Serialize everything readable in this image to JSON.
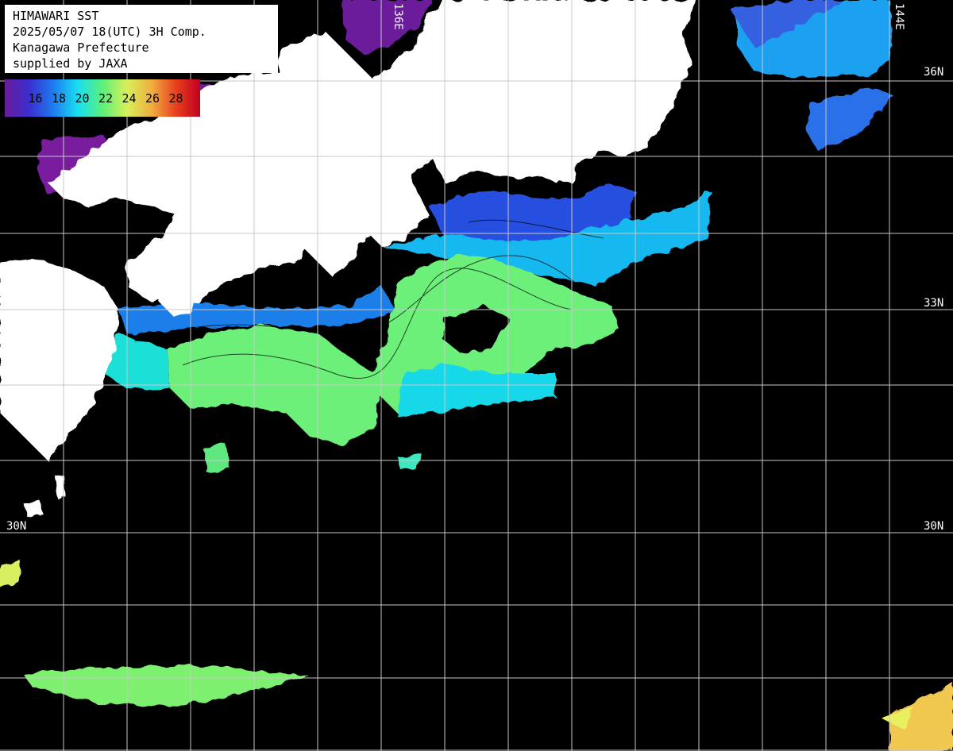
{
  "header": {
    "lines": [
      "HIMAWARI SST",
      "2025/05/07 18(UTC) 3H Comp.",
      "Kanagawa Prefecture",
      "supplied by JAXA"
    ]
  },
  "legend": {
    "labels": [
      "16",
      "18",
      "20",
      "22",
      "24",
      "26",
      "28"
    ],
    "gradient_colors": [
      "#6a1b9a",
      "#3a2fd0",
      "#1e7cf0",
      "#19e0f0",
      "#5cf07a",
      "#d8f05a",
      "#f0b040",
      "#e8401e",
      "#c00020"
    ]
  },
  "grid": {
    "lat_labels": [
      "36N",
      "33N",
      "30N",
      "30N"
    ],
    "lon_labels": [
      "136E",
      "144E"
    ]
  },
  "colors": {
    "land": "#ffffff",
    "no_data": "#000000",
    "grid": "#c8c8c8"
  }
}
